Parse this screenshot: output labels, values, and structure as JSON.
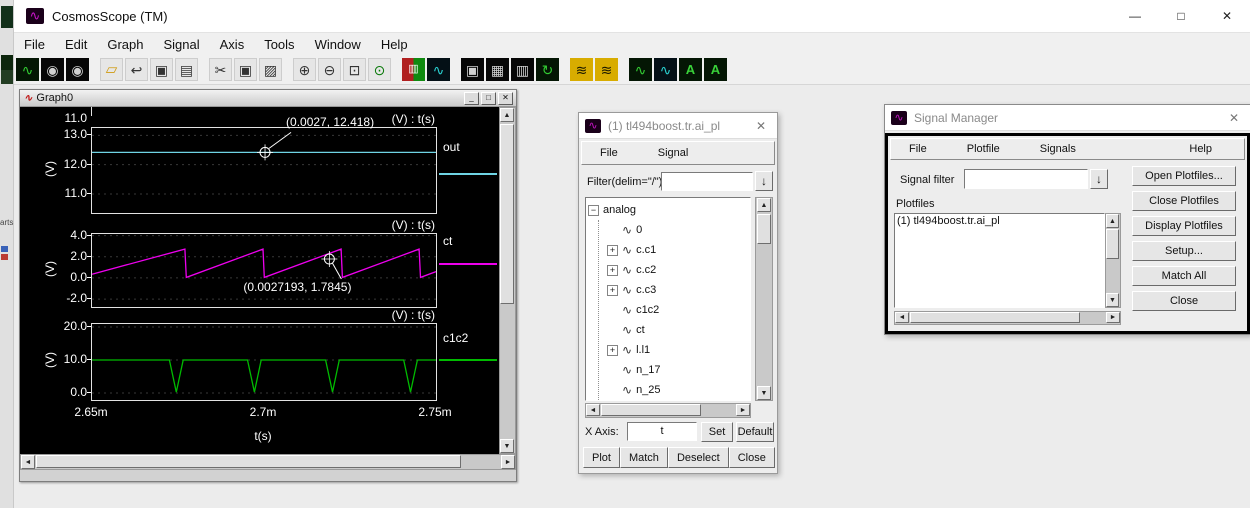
{
  "app": {
    "title": "CosmosScope (TM)",
    "window_controls": {
      "minimize": "—",
      "maximize": "□",
      "close": "✕"
    }
  },
  "menubar": {
    "items": [
      "File",
      "Edit",
      "Graph",
      "Signal",
      "Axis",
      "Tools",
      "Window",
      "Help"
    ]
  },
  "toolbar": {
    "icons": [
      {
        "name": "waveform-display-icon",
        "glyph": "∿",
        "cls": "ic-dkg"
      },
      {
        "name": "globe-icon-1",
        "glyph": "◉",
        "cls": "ic-dark"
      },
      {
        "name": "globe-icon-2",
        "glyph": "◉",
        "cls": "ic-dark"
      },
      {
        "name": "open-plotfiles-icon",
        "glyph": "▱",
        "cls": "ic-folder",
        "gap": true
      },
      {
        "name": "reread-icon",
        "glyph": "↩",
        "cls": "ic-lt"
      },
      {
        "name": "save-icon",
        "glyph": "▣",
        "cls": "ic-lt"
      },
      {
        "name": "print-icon",
        "glyph": "▤",
        "cls": "ic-lt"
      },
      {
        "name": "cut-icon",
        "glyph": "✂",
        "cls": "ic-lt",
        "gap": true
      },
      {
        "name": "copy-icon",
        "glyph": "▣",
        "cls": "ic-lt"
      },
      {
        "name": "paste-icon",
        "glyph": "▨",
        "cls": "ic-lt"
      },
      {
        "name": "zoom-in-icon",
        "glyph": "⊕",
        "cls": "ic-lt",
        "gap": true
      },
      {
        "name": "zoom-out-icon",
        "glyph": "⊖",
        "cls": "ic-lt"
      },
      {
        "name": "zoom-box-icon",
        "glyph": "⊡",
        "cls": "ic-lt"
      },
      {
        "name": "zoom-fit-icon",
        "glyph": "⊙",
        "cls": "ic-grn"
      },
      {
        "name": "plot-colors-icon",
        "glyph": "▥",
        "cls": "ic-rg",
        "gap": true
      },
      {
        "name": "waveform-window-icon",
        "glyph": "∿",
        "cls": "ic-dkc"
      },
      {
        "name": "snapshot-icon",
        "glyph": "▣",
        "cls": "ic-dark",
        "gap": true
      },
      {
        "name": "grid-icon",
        "glyph": "▦",
        "cls": "ic-dark"
      },
      {
        "name": "table-icon",
        "glyph": "▥",
        "cls": "ic-dark"
      },
      {
        "name": "redraw-icon",
        "glyph": "↻",
        "cls": "ic-dkg"
      },
      {
        "name": "measure-icon-1",
        "glyph": "≋",
        "cls": "ic-ylw",
        "gap": true
      },
      {
        "name": "measure-icon-2",
        "glyph": "≋",
        "cls": "ic-ylw"
      },
      {
        "name": "marker-icon-1",
        "glyph": "∿",
        "cls": "ic-dkg",
        "gap": true
      },
      {
        "name": "marker-icon-2",
        "glyph": "∿",
        "cls": "ic-dkc"
      },
      {
        "name": "label-icon-1",
        "glyph": "A",
        "cls": "ic-dkA"
      },
      {
        "name": "label-icon-2",
        "glyph": "A",
        "cls": "ic-dkA"
      }
    ]
  },
  "graph_window": {
    "title": "Graph0",
    "controls": {
      "minimize": "_",
      "maximize": "□",
      "close": "✕"
    },
    "clipped_tick": "11.0",
    "panels": [
      {
        "signal": "out",
        "header": "(V) : t(s)",
        "ylabel": "(V)",
        "color": "#6fd4e4",
        "ylim": [
          10.35,
          13.25
        ],
        "yticks": [
          {
            "v": 13,
            "label": "13.0"
          },
          {
            "v": 12,
            "label": "12.0"
          },
          {
            "v": 11,
            "label": "11.0"
          }
        ],
        "points": [
          [
            0,
            12.418
          ],
          [
            1,
            12.418
          ]
        ],
        "annotation": {
          "text": "(0.0027, 12.418)",
          "x": 0.503,
          "v": 12.418,
          "dir": "up"
        }
      },
      {
        "signal": "ct",
        "header": "(V) : t(s)",
        "ylabel": "(V)",
        "color": "#ee00ee",
        "ylim": [
          -2.75,
          4.15
        ],
        "yticks": [
          {
            "v": 4,
            "label": "4.0"
          },
          {
            "v": 2,
            "label": "2.0"
          },
          {
            "v": 0,
            "label": "0.0"
          },
          {
            "v": -2,
            "label": "-2.0"
          }
        ],
        "points": [
          [
            0,
            0.35
          ],
          [
            0.27,
            2.72
          ],
          [
            0.274,
            0.05
          ],
          [
            0.497,
            2.72
          ],
          [
            0.501,
            0.05
          ],
          [
            0.724,
            2.72
          ],
          [
            0.728,
            0.05
          ],
          [
            0.951,
            2.72
          ],
          [
            0.955,
            0.05
          ],
          [
            1,
            0.6
          ]
        ],
        "annotation": {
          "text": "(0.0027193, 1.7845)",
          "x": 0.69,
          "v": 1.7845,
          "dir": "down"
        }
      },
      {
        "signal": "c1c2",
        "header": "(V) : t(s)",
        "ylabel": "(V)",
        "color": "#00bb00",
        "ylim": [
          -2.1,
          20.9
        ],
        "yticks": [
          {
            "v": 20,
            "label": "20.0"
          },
          {
            "v": 10,
            "label": "10.0"
          },
          {
            "v": 0,
            "label": "0.0"
          }
        ],
        "points": [
          [
            0,
            10
          ],
          [
            0.225,
            10
          ],
          [
            0.245,
            0.3
          ],
          [
            0.265,
            10
          ],
          [
            0.452,
            10
          ],
          [
            0.472,
            0.3
          ],
          [
            0.492,
            10
          ],
          [
            0.679,
            10
          ],
          [
            0.699,
            0.3
          ],
          [
            0.719,
            10
          ],
          [
            0.906,
            10
          ],
          [
            0.926,
            0.3
          ],
          [
            0.946,
            10
          ],
          [
            1,
            10
          ]
        ],
        "xticks": [
          {
            "x": 0,
            "label": "2.65m"
          },
          {
            "x": 0.5,
            "label": "2.7m"
          },
          {
            "x": 1,
            "label": "2.75m"
          }
        ],
        "xlabel": "t(s)"
      }
    ]
  },
  "signal_browser": {
    "title": "(1) tl494boost.tr.ai_pl",
    "close": "✕",
    "menus": [
      "File",
      "Signal"
    ],
    "filter_label": "Filter(delim=\"/\")",
    "filter_value": "",
    "dropdown_arrow": "↓",
    "tree": {
      "root": {
        "label": "analog",
        "expander": "−"
      },
      "items": [
        {
          "label": "0",
          "plus": false
        },
        {
          "label": "c.c1",
          "plus": true
        },
        {
          "label": "c.c2",
          "plus": true
        },
        {
          "label": "c.c3",
          "plus": true
        },
        {
          "label": "c1c2",
          "plus": false
        },
        {
          "label": "ct",
          "plus": false
        },
        {
          "label": "l.l1",
          "plus": true
        },
        {
          "label": "n_17",
          "plus": false
        },
        {
          "label": "n_25",
          "plus": false
        }
      ]
    },
    "xaxis_label": "X Axis:",
    "xaxis_value": "t",
    "set_label": "Set",
    "default_label": "Default",
    "buttons": [
      "Plot",
      "Match",
      "Deselect",
      "Close"
    ]
  },
  "signal_manager": {
    "title": "Signal Manager",
    "close": "✕",
    "menus": [
      "File",
      "Plotfile",
      "Signals"
    ],
    "help_label": "Help",
    "filter_label": "Signal filter",
    "filter_value": "",
    "dropdown_arrow": "↓",
    "plotfiles_label": "Plotfiles",
    "plotfiles": [
      "(1) tl494boost.tr.ai_pl"
    ],
    "buttons": [
      "Open Plotfiles...",
      "Close Plotfiles",
      "Display Plotfiles",
      "Setup...",
      "Match All",
      "Close"
    ]
  },
  "background_sliver": {
    "text": "arts"
  }
}
